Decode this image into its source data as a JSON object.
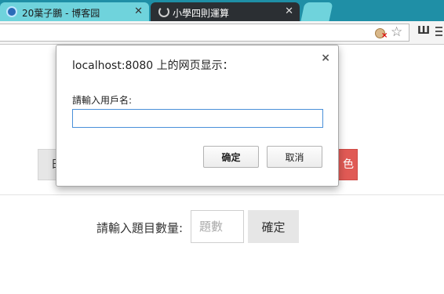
{
  "browser": {
    "tabs": [
      {
        "title": "20葉子鵬 - 博客园",
        "close": "✕"
      },
      {
        "title": "小學四則運算",
        "close": "✕"
      }
    ],
    "star": "☆",
    "ext_label": "Ш",
    "blocked_mark": "×"
  },
  "page": {
    "left_button_label": "日",
    "right_button_label": "色",
    "count_label": "請輸入題目數量:",
    "count_placeholder": "題數",
    "confirm_label": "確定"
  },
  "dialog": {
    "title": "localhost:8080 上的网页显示：",
    "close": "×",
    "prompt_label": "請輸入用戶名:",
    "input_value": "",
    "ok_label": "确定",
    "cancel_label": "取消"
  }
}
